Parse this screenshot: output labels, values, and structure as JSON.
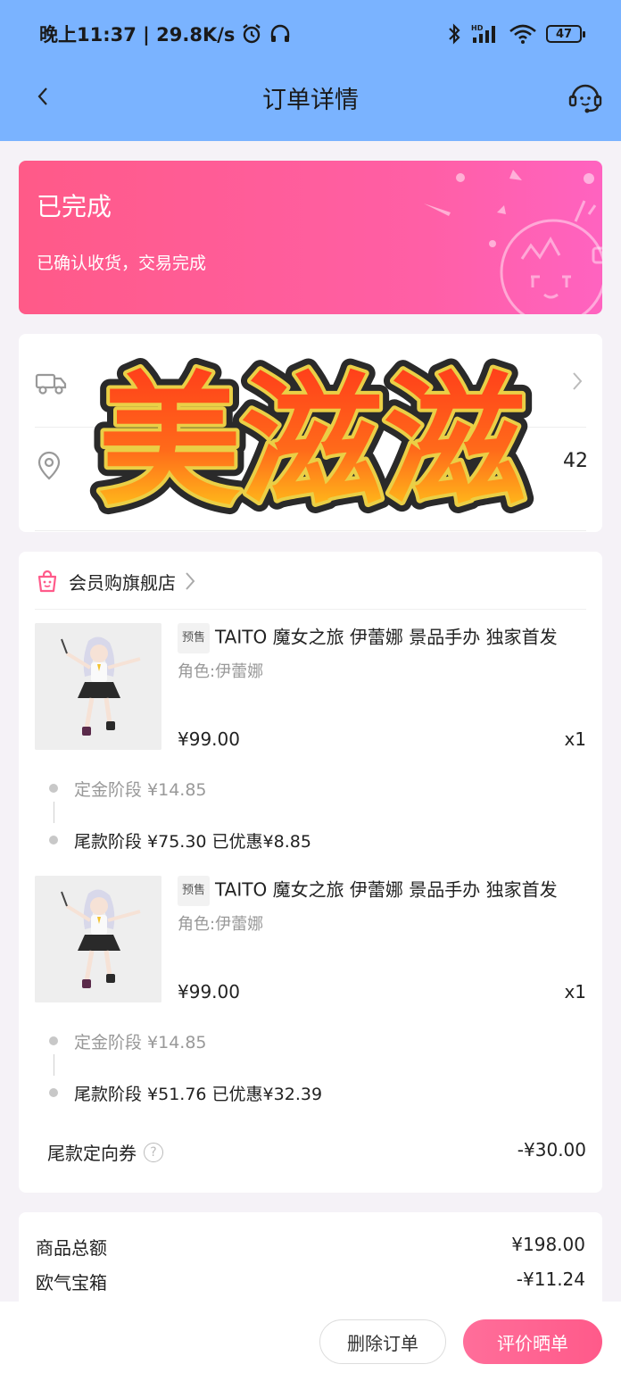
{
  "status_bar": {
    "time_speed": "晚上11:37 | 29.8K/s",
    "battery": "47"
  },
  "header": {
    "title": "订单详情"
  },
  "order_status": {
    "title": "已完成",
    "subtitle": "已确认收货，交易完成"
  },
  "logistics": {
    "address_tail": "42"
  },
  "sticker": {
    "text": "美滋滋"
  },
  "shop": {
    "name": "会员购旗舰店"
  },
  "items": [
    {
      "tag": "预售",
      "title": "TAITO 魔女之旅 伊蕾娜 景品手办 独家首发",
      "attr": "角色:伊蕾娜",
      "price": "¥99.00",
      "qty": "x1",
      "deposit": "定金阶段  ¥14.85",
      "final": "尾款阶段  ¥75.30  已优惠¥8.85"
    },
    {
      "tag": "预售",
      "title": "TAITO 魔女之旅 伊蕾娜 景品手办 独家首发",
      "attr": "角色:伊蕾娜",
      "price": "¥99.00",
      "qty": "x1",
      "deposit": "定金阶段  ¥14.85",
      "final": "尾款阶段  ¥51.76  已优惠¥32.39"
    }
  ],
  "coupon": {
    "label": "尾款定向券",
    "help": "?",
    "value": "-¥30.00"
  },
  "summary": {
    "goods_total_label": "商品总额",
    "goods_total_value": "¥198.00",
    "lucky_box_label": "欧气宝箱",
    "lucky_box_value": "-¥11.24"
  },
  "actions": {
    "delete": "删除订单",
    "review": "评价晒单"
  },
  "colors": {
    "header_bg": "#7ab3ff",
    "status_card": "#ff5a88",
    "accent_button": "#ff5a8a"
  }
}
